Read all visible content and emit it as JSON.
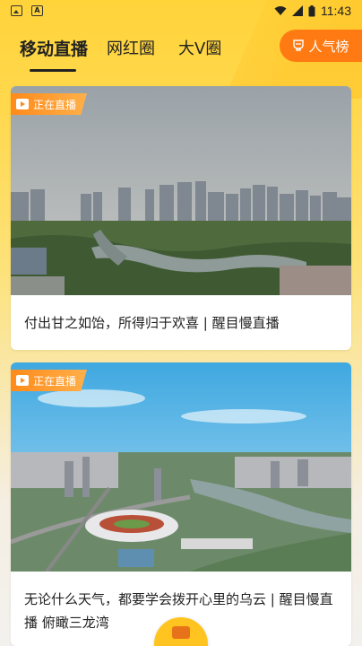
{
  "status_bar": {
    "time": "11:43"
  },
  "tabs": [
    {
      "label": "移动直播"
    },
    {
      "label": "网红圈"
    },
    {
      "label": "大V圈"
    }
  ],
  "rank_button": {
    "label": "人气榜"
  },
  "cards": [
    {
      "badge": "正在直播",
      "title": "付出甘之如饴，所得归于欢喜 | 醒目慢直播"
    },
    {
      "badge": "正在直播",
      "title": "无论什么天气，都要学会拨开心里的乌云 | 醒目慢直播 俯瞰三龙湾"
    }
  ]
}
